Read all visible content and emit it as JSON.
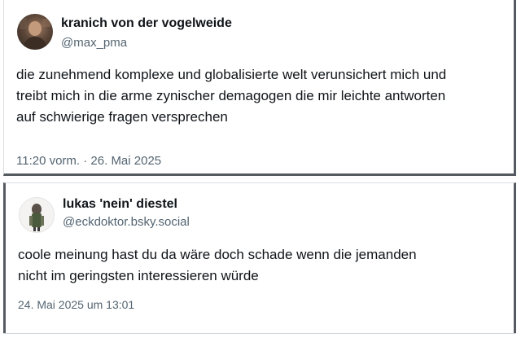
{
  "posts": [
    {
      "author_name": "kranich von der vogelweide",
      "handle": "@max_pma",
      "text": "die zunehmend komplexe und globalisierte welt verunsichert mich und\ntreibt mich in die arme zynischer demagogen die mir leichte antworten\nauf schwierige fragen versprechen",
      "timestamp": "11:20 vorm. · 26. Mai 2025"
    },
    {
      "author_name": "lukas 'nein' diestel",
      "handle": "@eckdoktor.bsky.social",
      "text": "coole meinung hast du da wäre doch schade wenn die jemanden\nnicht im geringsten interessieren würde",
      "timestamp": "24. Mai 2025 um 13:01"
    }
  ]
}
